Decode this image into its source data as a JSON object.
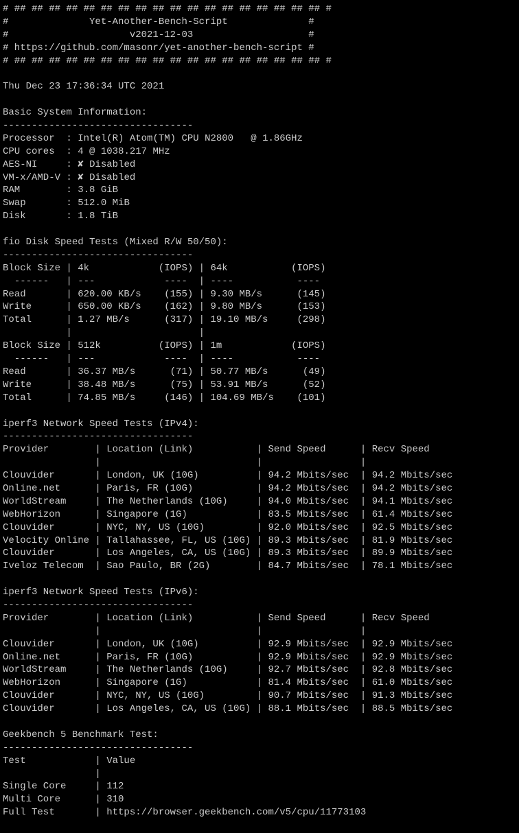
{
  "banner": {
    "border": "# ## ## ## ## ## ## ## ## ## ## ## ## ## ## ## ## ## ## #",
    "title": "#              Yet-Another-Bench-Script              #",
    "version": "#                     v2021-12-03                    #",
    "url": "# https://github.com/masonr/yet-another-bench-script #"
  },
  "timestamp": "Thu Dec 23 17:36:34 UTC 2021",
  "sysinfo_header": "Basic System Information:",
  "sysinfo_dashes": "---------------------------------",
  "sysinfo": {
    "processor_label": "Processor  :",
    "processor": "Intel(R) Atom(TM) CPU N2800   @ 1.86GHz",
    "cores_label": "CPU cores  :",
    "cores": "4 @ 1038.217 MHz",
    "aesni_label": "AES-NI     :",
    "aesni": "Disabled",
    "vmx_label": "VM-x/AMD-V :",
    "vmx": "Disabled",
    "ram_label": "RAM        :",
    "ram": "3.8 GiB",
    "swap_label": "Swap       :",
    "swap": "512.0 MiB",
    "disk_label": "Disk       :",
    "disk": "1.8 TiB"
  },
  "cross": "✘",
  "fio_header": "fio Disk Speed Tests (Mixed R/W 50/50):",
  "fio_dashes": "---------------------------------",
  "fio": {
    "hdr1": "Block Size | 4k            (IOPS) | 64k           (IOPS)",
    "dash1": "  ------   | ---            ----  | ----           ---- ",
    "r1": "Read       | 620.00 KB/s    (155) | 9.30 MB/s      (145)",
    "w1": "Write      | 650.00 KB/s    (162) | 9.80 MB/s      (153)",
    "t1": "Total      | 1.27 MB/s      (317) | 19.10 MB/s     (298)",
    "blank1": "           |                      |                     ",
    "hdr2": "Block Size | 512k          (IOPS) | 1m            (IOPS)",
    "dash2": "  ------   | ---            ----  | ----           ---- ",
    "r2": "Read       | 36.37 MB/s      (71) | 50.77 MB/s      (49)",
    "w2": "Write      | 38.48 MB/s      (75) | 53.91 MB/s      (52)",
    "t2": "Total      | 74.85 MB/s     (146) | 104.69 MB/s    (101)"
  },
  "iperf4_header": "iperf3 Network Speed Tests (IPv4):",
  "iperf_dashes": "---------------------------------",
  "iperf_columns": "Provider        | Location (Link)           | Send Speed      | Recv Speed     ",
  "iperf_blank": "                |                           |                 |                ",
  "iperf4": {
    "r0": "Clouvider       | London, UK (10G)          | 94.2 Mbits/sec  | 94.2 Mbits/sec ",
    "r1": "Online.net      | Paris, FR (10G)           | 94.2 Mbits/sec  | 94.2 Mbits/sec ",
    "r2": "WorldStream     | The Netherlands (10G)     | 94.0 Mbits/sec  | 94.1 Mbits/sec ",
    "r3": "WebHorizon      | Singapore (1G)            | 83.5 Mbits/sec  | 61.4 Mbits/sec ",
    "r4": "Clouvider       | NYC, NY, US (10G)         | 92.0 Mbits/sec  | 92.5 Mbits/sec ",
    "r5": "Velocity Online | Tallahassee, FL, US (10G) | 89.3 Mbits/sec  | 81.9 Mbits/sec ",
    "r6": "Clouvider       | Los Angeles, CA, US (10G) | 89.3 Mbits/sec  | 89.9 Mbits/sec ",
    "r7": "Iveloz Telecom  | Sao Paulo, BR (2G)        | 84.7 Mbits/sec  | 78.1 Mbits/sec "
  },
  "iperf6_header": "iperf3 Network Speed Tests (IPv6):",
  "iperf6": {
    "r0": "Clouvider       | London, UK (10G)          | 92.9 Mbits/sec  | 92.9 Mbits/sec ",
    "r1": "Online.net      | Paris, FR (10G)           | 92.9 Mbits/sec  | 92.9 Mbits/sec ",
    "r2": "WorldStream     | The Netherlands (10G)     | 92.7 Mbits/sec  | 92.8 Mbits/sec ",
    "r3": "WebHorizon      | Singapore (1G)            | 81.4 Mbits/sec  | 61.0 Mbits/sec ",
    "r4": "Clouvider       | NYC, NY, US (10G)         | 90.7 Mbits/sec  | 91.3 Mbits/sec ",
    "r5": "Clouvider       | Los Angeles, CA, US (10G) | 88.1 Mbits/sec  | 88.5 Mbits/sec "
  },
  "geek_header": "Geekbench 5 Benchmark Test:",
  "geek_dashes": "---------------------------------",
  "geek": {
    "hdr": "Test            | Value                         ",
    "blank": "                |                               ",
    "sc": "Single Core     | 112                           ",
    "mc": "Multi Core      | 310                           ",
    "ft": "Full Test       | https://browser.geekbench.com/v5/cpu/11773103"
  }
}
